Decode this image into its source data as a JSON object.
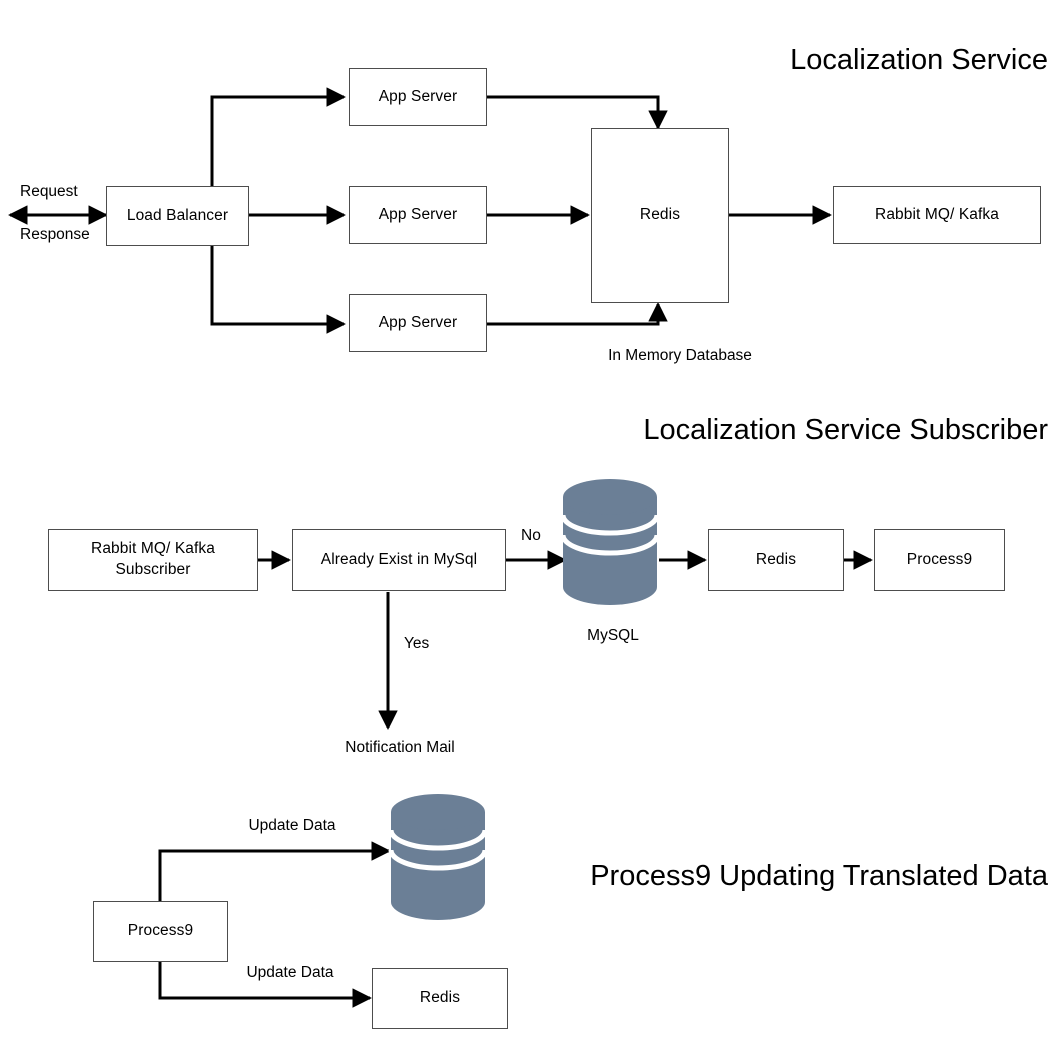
{
  "document": {
    "kind": "architecture-flow-diagram",
    "background_color": "#ffffff",
    "line_color": "#000000",
    "box_border_color": "#4d4d4d",
    "cylinder_color": "#6b7f96"
  },
  "sections": [
    {
      "id": "localization-service",
      "title": "Localization Service",
      "nodes": [
        {
          "id": "load-balancer",
          "label": "Load Balancer"
        },
        {
          "id": "app-server-1",
          "label": "App Server"
        },
        {
          "id": "app-server-2",
          "label": "App Server"
        },
        {
          "id": "app-server-3",
          "label": "App Server"
        },
        {
          "id": "redis",
          "label": "Redis"
        },
        {
          "id": "rabbit-mq-kafka",
          "label": "Rabbit MQ/ Kafka"
        }
      ],
      "edge_labels": [
        {
          "id": "request",
          "text": "Request"
        },
        {
          "id": "response",
          "text": "Response"
        }
      ],
      "annotations": [
        {
          "id": "in-memory-database",
          "text": "In Memory Database"
        }
      ]
    },
    {
      "id": "localization-service-subscriber",
      "title": "Localization Service Subscriber",
      "nodes": [
        {
          "id": "rabbit-mq-kafka-subscriber",
          "label_line_1": "Rabbit MQ/ Kafka",
          "label_line_2": "Subscriber"
        },
        {
          "id": "already-exist-in-mysql",
          "label": "Already Exist in MySql"
        },
        {
          "id": "mysql-database",
          "label": "MySQL"
        },
        {
          "id": "redis",
          "label": "Redis"
        },
        {
          "id": "process9",
          "label": "Process9"
        }
      ],
      "edge_labels": [
        {
          "id": "no",
          "text": "No"
        },
        {
          "id": "yes",
          "text": "Yes"
        }
      ],
      "annotations": [
        {
          "id": "notification-mail",
          "text": "Notification Mail"
        }
      ]
    },
    {
      "id": "process9-updating-translated-data",
      "title": "Process9 Updating Translated Data",
      "nodes": [
        {
          "id": "process9",
          "label": "Process9"
        },
        {
          "id": "mysql-database",
          "label": ""
        },
        {
          "id": "redis",
          "label": "Redis"
        }
      ],
      "edge_labels": [
        {
          "id": "update-data-top",
          "text": "Update Data"
        },
        {
          "id": "update-data-bottom",
          "text": "Update Data"
        }
      ]
    }
  ]
}
